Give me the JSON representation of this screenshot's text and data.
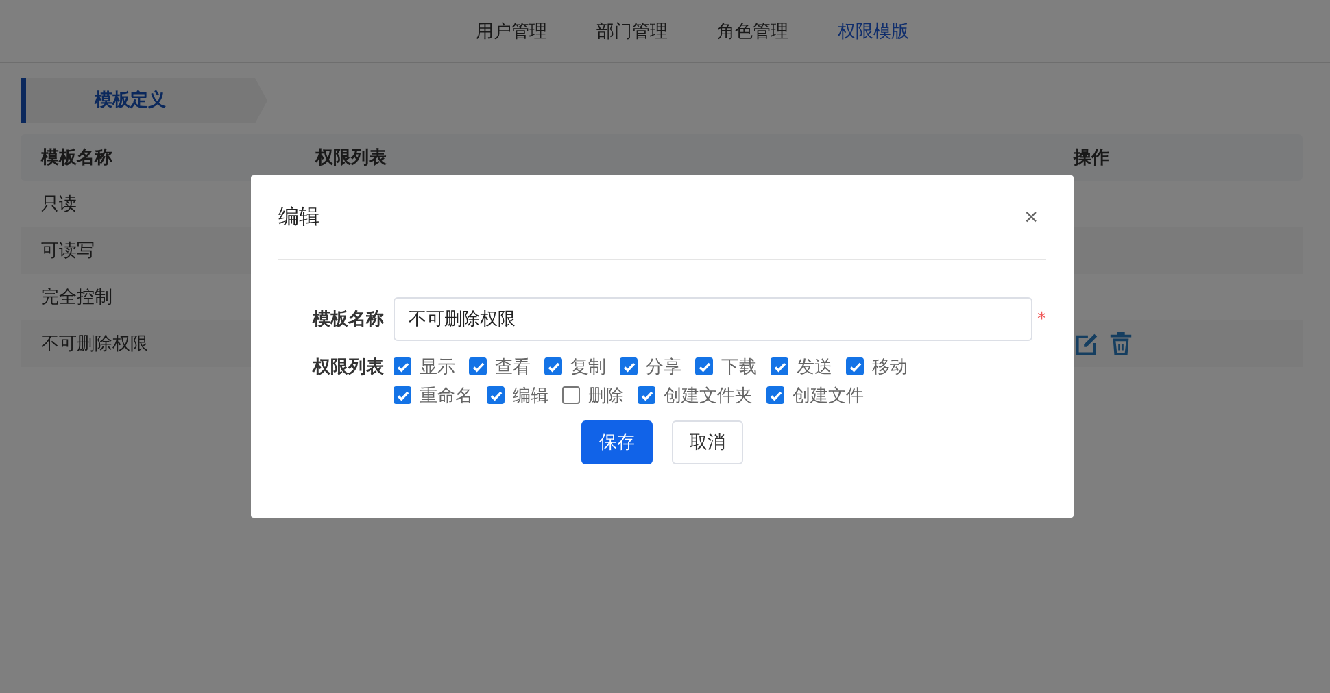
{
  "nav": [
    {
      "label": "用户管理",
      "selected": false
    },
    {
      "label": "部门管理",
      "selected": false
    },
    {
      "label": "角色管理",
      "selected": false
    },
    {
      "label": "权限模版",
      "selected": true
    }
  ],
  "section_tab": {
    "label": "模板定义"
  },
  "table": {
    "columns": [
      "模板名称",
      "权限列表",
      "操作"
    ],
    "rows": [
      {
        "name": "只读",
        "show_actions": false
      },
      {
        "name": "可读写",
        "show_actions": false
      },
      {
        "name": "完全控制",
        "show_actions": false
      },
      {
        "name": "不可删除权限",
        "show_actions": true
      }
    ]
  },
  "dialog": {
    "title": "编辑",
    "close": "×",
    "name_label": "模板名称",
    "name_value": "不可删除权限",
    "required": "*",
    "permissions_label": "权限列表",
    "permissions": [
      {
        "label": "显示",
        "checked": true
      },
      {
        "label": "查看",
        "checked": true
      },
      {
        "label": "复制",
        "checked": true
      },
      {
        "label": "分享",
        "checked": true
      },
      {
        "label": "下载",
        "checked": true
      },
      {
        "label": "发送",
        "checked": true
      },
      {
        "label": "移动",
        "checked": true
      },
      {
        "label": "重命名",
        "checked": true
      },
      {
        "label": "编辑",
        "checked": true
      },
      {
        "label": "删除",
        "checked": false
      },
      {
        "label": "创建文件夹",
        "checked": true
      },
      {
        "label": "创建文件",
        "checked": true
      }
    ],
    "buttons": [
      {
        "label": "保存",
        "kind": "primary"
      },
      {
        "label": "取消",
        "kind": "default"
      }
    ]
  }
}
